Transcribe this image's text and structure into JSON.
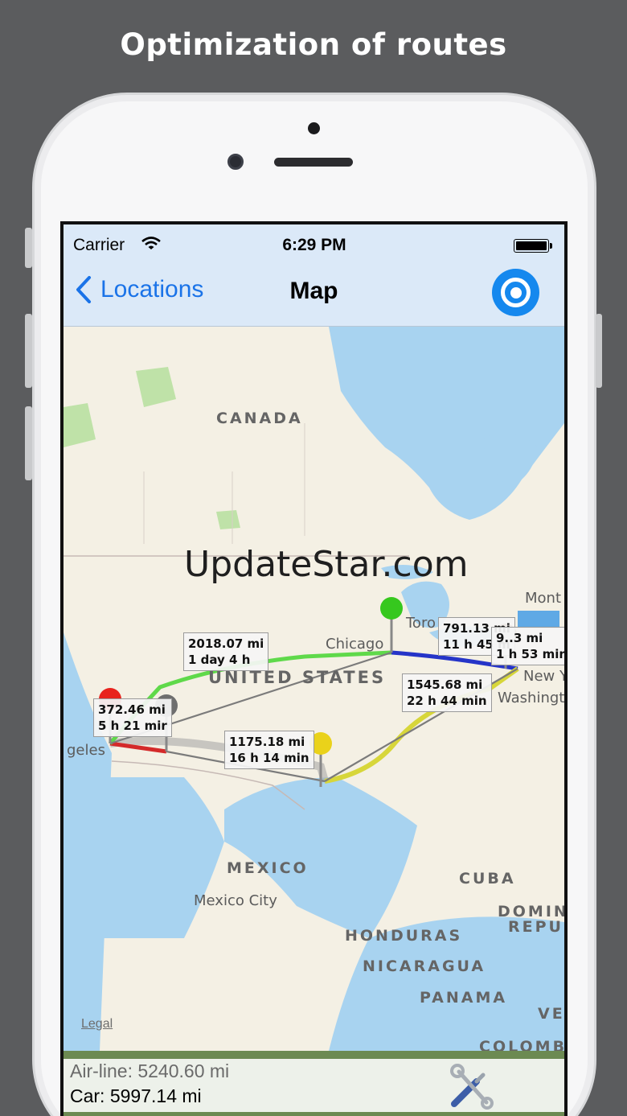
{
  "promo": {
    "title": "Optimization of routes"
  },
  "status_bar": {
    "carrier": "Carrier",
    "time": "6:29 PM"
  },
  "nav": {
    "back_label": "Locations",
    "title": "Map"
  },
  "map": {
    "labels": {
      "canada": "CANADA",
      "united_states": "UNITED STATES",
      "mexico": "MEXICO",
      "cuba": "CUBA",
      "dominican_1": "DOMIN",
      "dominican_2": "REPUB",
      "honduras": "HONDURAS",
      "nicaragua": "NICARAGUA",
      "panama": "PANAMA",
      "venezuela": "VE",
      "colombia": "COLOMBI",
      "chicago": "Chicago",
      "toronto": "Toro",
      "montreal": "Mont",
      "new_york": "New Y",
      "washington": "Washingt",
      "los_angeles": "geles",
      "mexico_city": "Mexico City"
    },
    "watermark": "UpdateStar.com",
    "legal": "Legal",
    "callouts": {
      "la_east": {
        "distance": "372.46 mi",
        "duration": "5 h 21 mir"
      },
      "west_chicago": {
        "distance": "2018.07 mi",
        "duration": "1 day 4 h"
      },
      "texas": {
        "distance": "1175.18 mi",
        "duration": "16 h 14 min"
      },
      "dc": {
        "distance": "1545.68 mi",
        "duration": "22 h 44 min"
      },
      "toronto": {
        "distance": "791.13 mi",
        "duration": "11 h 45 m"
      },
      "ny": {
        "distance": "9..3 mi",
        "duration": "1 h 53 min"
      }
    },
    "pins": [
      {
        "name": "red",
        "color": "#e8231d"
      },
      {
        "name": "gray",
        "color": "#6e6e6e"
      },
      {
        "name": "green",
        "color": "#36c81e"
      },
      {
        "name": "yellow",
        "color": "#ead21a"
      },
      {
        "name": "brown",
        "color": "#8a5a2e"
      }
    ],
    "route_colors": {
      "red": "#d42a2a",
      "green": "#5fd94a",
      "blue": "#2534c8",
      "yellow": "#d7d63a",
      "gray": "#7b7b7b"
    }
  },
  "footer": {
    "airline": "Air-line: 5240.60 mi",
    "car": "Car: 5997.14 mi"
  },
  "icons": {
    "back": "chevron-left-icon",
    "locate": "locate-icon",
    "wifi": "wifi-icon",
    "battery": "battery-icon",
    "tools": "tools-icon"
  }
}
